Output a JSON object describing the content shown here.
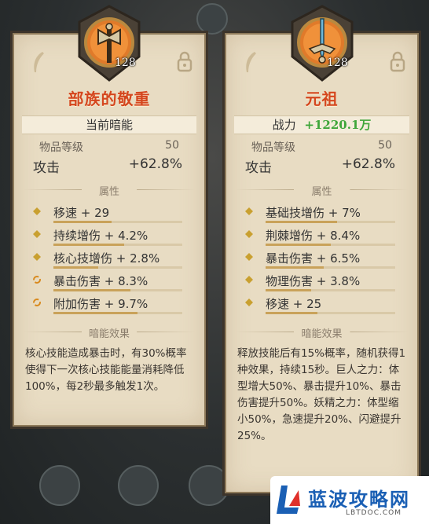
{
  "left_card": {
    "level": "128",
    "title": "部族的敬重",
    "bar_label": "当前暗能",
    "item_level_label": "物品等级",
    "item_level_value": "50",
    "attack_label": "攻击",
    "attack_value": "+62.8%",
    "section_attributes": "属性",
    "stats": [
      {
        "text": "移速 + 29",
        "icon": "diamond-icon",
        "fill": 0.45
      },
      {
        "text": "持续增伤 + 4.2%",
        "icon": "diamond-icon",
        "fill": 0.55
      },
      {
        "text": "核心技增伤 + 2.8%",
        "icon": "diamond-icon",
        "fill": 0.35
      },
      {
        "text": "暴击伤害 + 8.3%",
        "icon": "swirl-icon",
        "fill": 0.6
      },
      {
        "text": "附加伤害 + 9.7%",
        "icon": "swirl-icon",
        "fill": 0.65
      }
    ],
    "section_effect": "暗能效果",
    "description": "核心技能造成暴击时，有30%概率使得下一次核心技能能量消耗降低100%，每2秒最多触发1次。"
  },
  "right_card": {
    "level": "128",
    "title": "元祖",
    "bar_label": "战力",
    "power_value": "+1220.1万",
    "item_level_label": "物品等级",
    "item_level_value": "50",
    "attack_label": "攻击",
    "attack_value": "+62.8%",
    "section_attributes": "属性",
    "stats": [
      {
        "text": "基础技增伤 + 7%",
        "icon": "diamond-icon",
        "fill": 0.55
      },
      {
        "text": "荆棘增伤 + 8.4%",
        "icon": "diamond-icon",
        "fill": 0.5
      },
      {
        "text": "暴击伤害 + 6.5%",
        "icon": "diamond-icon",
        "fill": 0.45
      },
      {
        "text": "物理伤害 + 3.8%",
        "icon": "diamond-icon",
        "fill": 0.35
      },
      {
        "text": "移速 + 25",
        "icon": "diamond-icon",
        "fill": 0.4
      }
    ],
    "section_effect": "暗能效果",
    "description": "释放技能后有15%概率，随机获得1种效果，持续15秒。巨人之力：体型增大50%、暴击提升10%、暴击伤害提升50%。妖精之力：体型缩小50%，急速提升20%、闪避提升25%。"
  },
  "watermark": {
    "name": "蓝波攻略网",
    "url": "LBTDOC.COM"
  },
  "colors": {
    "title_red": "#d4461e",
    "power_green": "#3fa63a",
    "card_bg": "#e8dcc3",
    "stat_icon_gold": "#c9a030",
    "swirl_orange": "#d98a1e"
  }
}
